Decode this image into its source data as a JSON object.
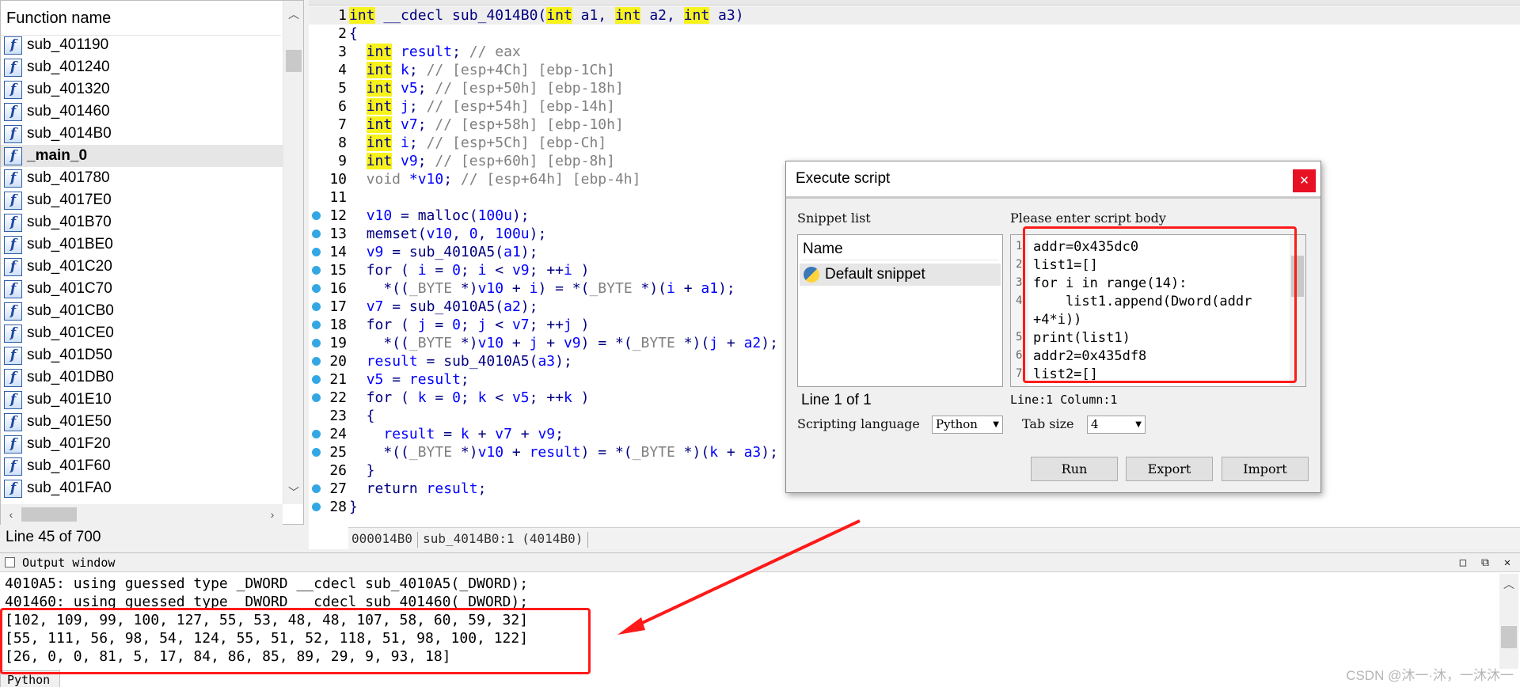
{
  "function_panel": {
    "header": "Function name",
    "items": [
      {
        "name": "sub_401190",
        "selected": false
      },
      {
        "name": "sub_401240",
        "selected": false
      },
      {
        "name": "sub_401320",
        "selected": false
      },
      {
        "name": "sub_401460",
        "selected": false
      },
      {
        "name": "sub_4014B0",
        "selected": false
      },
      {
        "name": "_main_0",
        "selected": true
      },
      {
        "name": "sub_401780",
        "selected": false
      },
      {
        "name": "sub_4017E0",
        "selected": false
      },
      {
        "name": "sub_401B70",
        "selected": false
      },
      {
        "name": "sub_401BE0",
        "selected": false
      },
      {
        "name": "sub_401C20",
        "selected": false
      },
      {
        "name": "sub_401C70",
        "selected": false
      },
      {
        "name": "sub_401CB0",
        "selected": false
      },
      {
        "name": "sub_401CE0",
        "selected": false
      },
      {
        "name": "sub_401D50",
        "selected": false
      },
      {
        "name": "sub_401DB0",
        "selected": false
      },
      {
        "name": "sub_401E10",
        "selected": false
      },
      {
        "name": "sub_401E50",
        "selected": false
      },
      {
        "name": "sub_401F20",
        "selected": false
      },
      {
        "name": "sub_401F60",
        "selected": false
      },
      {
        "name": "sub_401FA0",
        "selected": false
      }
    ],
    "icon": "function-icon",
    "status": "Line 45 of 700"
  },
  "code": {
    "lines": [
      {
        "n": "1",
        "bp": false,
        "t": [
          [
            "kw",
            "int"
          ],
          [
            "p",
            " __cdecl sub_4014B0("
          ],
          [
            "kw",
            "int"
          ],
          [
            "p",
            " a1, "
          ],
          [
            "kw",
            "int"
          ],
          [
            "p",
            " a2, "
          ],
          [
            "kw",
            "int"
          ],
          [
            "p",
            " a3)"
          ]
        ]
      },
      {
        "n": "2",
        "bp": false,
        "t": [
          [
            "p",
            "{"
          ]
        ]
      },
      {
        "n": "3",
        "bp": false,
        "t": [
          [
            "p",
            "  "
          ],
          [
            "kw",
            "int"
          ],
          [
            "v",
            " result"
          ],
          [
            "p",
            "; "
          ],
          [
            "cm",
            "// eax"
          ]
        ]
      },
      {
        "n": "4",
        "bp": false,
        "t": [
          [
            "p",
            "  "
          ],
          [
            "kw",
            "int"
          ],
          [
            "v",
            " k"
          ],
          [
            "p",
            "; "
          ],
          [
            "cm",
            "// [esp+4Ch] [ebp-1Ch]"
          ]
        ]
      },
      {
        "n": "5",
        "bp": false,
        "t": [
          [
            "p",
            "  "
          ],
          [
            "kw",
            "int"
          ],
          [
            "v",
            " v5"
          ],
          [
            "p",
            "; "
          ],
          [
            "cm",
            "// [esp+50h] [ebp-18h]"
          ]
        ]
      },
      {
        "n": "6",
        "bp": false,
        "t": [
          [
            "p",
            "  "
          ],
          [
            "kw",
            "int"
          ],
          [
            "v",
            " j"
          ],
          [
            "p",
            "; "
          ],
          [
            "cm",
            "// [esp+54h] [ebp-14h]"
          ]
        ]
      },
      {
        "n": "7",
        "bp": false,
        "t": [
          [
            "p",
            "  "
          ],
          [
            "kw",
            "int"
          ],
          [
            "v",
            " v7"
          ],
          [
            "p",
            "; "
          ],
          [
            "cm",
            "// [esp+58h] [ebp-10h]"
          ]
        ]
      },
      {
        "n": "8",
        "bp": false,
        "t": [
          [
            "p",
            "  "
          ],
          [
            "kw",
            "int"
          ],
          [
            "v",
            " i"
          ],
          [
            "p",
            "; "
          ],
          [
            "cm",
            "// [esp+5Ch] [ebp-Ch]"
          ]
        ]
      },
      {
        "n": "9",
        "bp": false,
        "t": [
          [
            "p",
            "  "
          ],
          [
            "kw",
            "int"
          ],
          [
            "v",
            " v9"
          ],
          [
            "p",
            "; "
          ],
          [
            "cm",
            "// [esp+60h] [ebp-8h]"
          ]
        ]
      },
      {
        "n": "10",
        "bp": false,
        "t": [
          [
            "cm",
            "  void "
          ],
          [
            "v",
            "*v10"
          ],
          [
            "p",
            "; "
          ],
          [
            "cm",
            "// [esp+64h] [ebp-4h]"
          ]
        ]
      },
      {
        "n": "11",
        "bp": false,
        "t": [
          [
            "p",
            ""
          ]
        ]
      },
      {
        "n": "12",
        "bp": true,
        "t": [
          [
            "p",
            "  "
          ],
          [
            "v",
            "v10"
          ],
          [
            "p",
            " = "
          ],
          [
            "fn",
            "malloc"
          ],
          [
            "p",
            "("
          ],
          [
            "v",
            "100u"
          ],
          [
            "p",
            ");"
          ]
        ]
      },
      {
        "n": "13",
        "bp": true,
        "t": [
          [
            "p",
            "  "
          ],
          [
            "fn",
            "memset"
          ],
          [
            "p",
            "("
          ],
          [
            "v",
            "v10"
          ],
          [
            "p",
            ", "
          ],
          [
            "v",
            "0"
          ],
          [
            "p",
            ", "
          ],
          [
            "v",
            "100u"
          ],
          [
            "p",
            ");"
          ]
        ]
      },
      {
        "n": "14",
        "bp": true,
        "t": [
          [
            "p",
            "  "
          ],
          [
            "v",
            "v9"
          ],
          [
            "p",
            " = "
          ],
          [
            "fn",
            "sub_4010A5"
          ],
          [
            "p",
            "("
          ],
          [
            "v",
            "a1"
          ],
          [
            "p",
            ");"
          ]
        ]
      },
      {
        "n": "15",
        "bp": true,
        "t": [
          [
            "p",
            "  for ( "
          ],
          [
            "v",
            "i"
          ],
          [
            "p",
            " = "
          ],
          [
            "v",
            "0"
          ],
          [
            "p",
            "; "
          ],
          [
            "v",
            "i"
          ],
          [
            "p",
            " < "
          ],
          [
            "v",
            "v9"
          ],
          [
            "p",
            "; ++"
          ],
          [
            "v",
            "i"
          ],
          [
            "p",
            " )"
          ]
        ]
      },
      {
        "n": "16",
        "bp": true,
        "t": [
          [
            "p",
            "    *(("
          ],
          [
            "cm",
            "_BYTE"
          ],
          [
            "p",
            " *)"
          ],
          [
            "v",
            "v10"
          ],
          [
            "p",
            " + "
          ],
          [
            "v",
            "i"
          ],
          [
            "p",
            ") = *("
          ],
          [
            "cm",
            "_BYTE"
          ],
          [
            "p",
            " *)("
          ],
          [
            "v",
            "i"
          ],
          [
            "p",
            " + "
          ],
          [
            "v",
            "a1"
          ],
          [
            "p",
            ");"
          ]
        ]
      },
      {
        "n": "17",
        "bp": true,
        "t": [
          [
            "p",
            "  "
          ],
          [
            "v",
            "v7"
          ],
          [
            "p",
            " = "
          ],
          [
            "fn",
            "sub_4010A5"
          ],
          [
            "p",
            "("
          ],
          [
            "v",
            "a2"
          ],
          [
            "p",
            ");"
          ]
        ]
      },
      {
        "n": "18",
        "bp": true,
        "t": [
          [
            "p",
            "  for ( "
          ],
          [
            "v",
            "j"
          ],
          [
            "p",
            " = "
          ],
          [
            "v",
            "0"
          ],
          [
            "p",
            "; "
          ],
          [
            "v",
            "j"
          ],
          [
            "p",
            " < "
          ],
          [
            "v",
            "v7"
          ],
          [
            "p",
            "; ++"
          ],
          [
            "v",
            "j"
          ],
          [
            "p",
            " )"
          ]
        ]
      },
      {
        "n": "19",
        "bp": true,
        "t": [
          [
            "p",
            "    *(("
          ],
          [
            "cm",
            "_BYTE"
          ],
          [
            "p",
            " *)"
          ],
          [
            "v",
            "v10"
          ],
          [
            "p",
            " + "
          ],
          [
            "v",
            "j"
          ],
          [
            "p",
            " + "
          ],
          [
            "v",
            "v9"
          ],
          [
            "p",
            ") = *("
          ],
          [
            "cm",
            "_BYTE"
          ],
          [
            "p",
            " *)("
          ],
          [
            "v",
            "j"
          ],
          [
            "p",
            " + "
          ],
          [
            "v",
            "a2"
          ],
          [
            "p",
            ");"
          ]
        ]
      },
      {
        "n": "20",
        "bp": true,
        "t": [
          [
            "p",
            "  "
          ],
          [
            "v",
            "result"
          ],
          [
            "p",
            " = "
          ],
          [
            "fn",
            "sub_4010A5"
          ],
          [
            "p",
            "("
          ],
          [
            "v",
            "a3"
          ],
          [
            "p",
            ");"
          ]
        ]
      },
      {
        "n": "21",
        "bp": true,
        "t": [
          [
            "p",
            "  "
          ],
          [
            "v",
            "v5"
          ],
          [
            "p",
            " = "
          ],
          [
            "v",
            "result"
          ],
          [
            "p",
            ";"
          ]
        ]
      },
      {
        "n": "22",
        "bp": true,
        "t": [
          [
            "p",
            "  for ( "
          ],
          [
            "v",
            "k"
          ],
          [
            "p",
            " = "
          ],
          [
            "v",
            "0"
          ],
          [
            "p",
            "; "
          ],
          [
            "v",
            "k"
          ],
          [
            "p",
            " < "
          ],
          [
            "v",
            "v5"
          ],
          [
            "p",
            "; ++"
          ],
          [
            "v",
            "k"
          ],
          [
            "p",
            " )"
          ]
        ]
      },
      {
        "n": "23",
        "bp": false,
        "t": [
          [
            "p",
            "  {"
          ]
        ]
      },
      {
        "n": "24",
        "bp": true,
        "t": [
          [
            "p",
            "    "
          ],
          [
            "v",
            "result"
          ],
          [
            "p",
            " = "
          ],
          [
            "v",
            "k"
          ],
          [
            "p",
            " + "
          ],
          [
            "v",
            "v7"
          ],
          [
            "p",
            " + "
          ],
          [
            "v",
            "v9"
          ],
          [
            "p",
            ";"
          ]
        ]
      },
      {
        "n": "25",
        "bp": true,
        "t": [
          [
            "p",
            "    *(("
          ],
          [
            "cm",
            "_BYTE"
          ],
          [
            "p",
            " *)"
          ],
          [
            "v",
            "v10"
          ],
          [
            "p",
            " + "
          ],
          [
            "v",
            "result"
          ],
          [
            "p",
            ") = *("
          ],
          [
            "cm",
            "_BYTE"
          ],
          [
            "p",
            " *)("
          ],
          [
            "v",
            "k"
          ],
          [
            "p",
            " + "
          ],
          [
            "v",
            "a3"
          ],
          [
            "p",
            ");"
          ]
        ]
      },
      {
        "n": "26",
        "bp": false,
        "t": [
          [
            "p",
            "  }"
          ]
        ]
      },
      {
        "n": "27",
        "bp": true,
        "t": [
          [
            "p",
            "  return "
          ],
          [
            "v",
            "result"
          ],
          [
            "p",
            ";"
          ]
        ]
      },
      {
        "n": "28",
        "bp": true,
        "t": [
          [
            "p",
            "}"
          ]
        ]
      }
    ],
    "status_address": "000014B0",
    "status_location": "sub_4014B0:1 (4014B0)"
  },
  "output": {
    "title": "Output window",
    "lines": [
      "4010A5: using guessed type _DWORD __cdecl sub_4010A5(_DWORD);",
      "401460: using guessed type _DWORD __cdecl sub_401460(_DWORD);",
      "[102, 109, 99, 100, 127, 55, 53, 48, 48, 107, 58, 60, 59, 32]",
      "[55, 111, 56, 98, 54, 124, 55, 51, 52, 118, 51, 98, 100, 122]",
      "[26, 0, 0, 81, 5, 17, 84, 86, 85, 89, 29, 9, 93, 18]"
    ],
    "tab": "Python",
    "window_buttons": [
      "□",
      "⧉",
      "✕"
    ],
    "watermark": "CSDN @沐一·沐，一沐沐一"
  },
  "dialog": {
    "title": "Execute script",
    "close": "✕",
    "snippet_list_label": "Snippet list",
    "snippet_column": "Name",
    "snippet_item": "Default snippet",
    "line_count": "Line 1 of 1",
    "script_label": "Please enter script body",
    "script_lines": [
      "addr=0x435dc0",
      "list1=[]",
      "for i in range(14):",
      "    list1.append(Dword(addr",
      "+4*i))",
      "print(list1)",
      "addr2=0x435df8",
      "list2=[]"
    ],
    "gutter_numbers": [
      "1",
      "2",
      "3",
      "4",
      "",
      "5",
      "6",
      "7"
    ],
    "script_position": "Line:1  Column:1",
    "language_label": "Scripting language",
    "language_value": "Python",
    "tab_size_label": "Tab size",
    "tab_size_value": "4",
    "buttons": {
      "run": "Run",
      "export": "Export",
      "import": "Import"
    }
  },
  "annotation_color": "#ff1a1a"
}
